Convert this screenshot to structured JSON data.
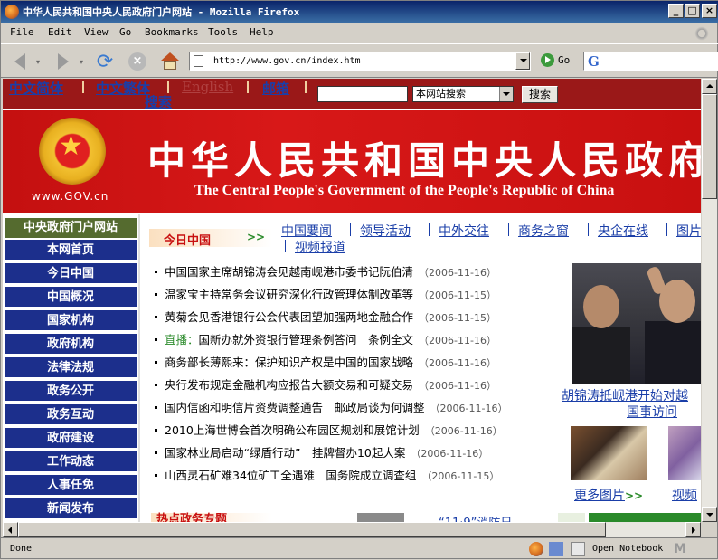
{
  "window": {
    "title": "中华人民共和国中央人民政府门户网站 - Mozilla Firefox",
    "buttons": {
      "minimize": "_",
      "maximize": "□",
      "close": "×"
    }
  },
  "menu": [
    "File",
    "Edit",
    "View",
    "Go",
    "Bookmarks",
    "Tools",
    "Help"
  ],
  "toolbar": {
    "url": "http://www.gov.cn/index.htm",
    "go_label": "Go",
    "search_engine_glyph": "G"
  },
  "status": {
    "text": "Done",
    "notebook_label": "Open Notebook"
  },
  "page": {
    "lang_links": [
      "中文简体",
      "中文繁体",
      "English",
      "邮箱"
    ],
    "search_label": "搜索",
    "search_scope": "本网站搜索",
    "search_button": "搜索",
    "site_url": "www.GOV.cn",
    "banner_cn": "中华人民共和国中央人民政府",
    "banner_en": "The Central People's Government of the People's Republic of China",
    "sidebar_title": "中央政府门户网站",
    "sidebar_items": [
      "本网首页",
      "今日中国",
      "中国概况",
      "国家机构",
      "政府机构",
      "法律法规",
      "政务公开",
      "政务互动",
      "政府建设",
      "工作动态",
      "人事任免",
      "新闻发布"
    ],
    "today_label": "今日中国",
    "today_arrow": ">>",
    "tabs": [
      "中国要闻",
      "领导活动",
      "中外交往",
      "商务之窗",
      "央企在线",
      "图片"
    ],
    "tabs_row2": "视频报道",
    "news": [
      {
        "title": "中国国家主席胡锦涛会见越南岘港市委书记阮伯清",
        "date": "（2006-11-16）"
      },
      {
        "title": "温家宝主持常务会议研究深化行政管理体制改革等",
        "date": "（2006-11-15）"
      },
      {
        "title": "黄菊会见香港银行公会代表团望加强两地金融合作",
        "date": "（2006-11-15）"
      },
      {
        "prefix": "直播：",
        "title": "国新办就外资银行管理条例答问　条例全文",
        "date": "（2006-11-16）"
      },
      {
        "title": "商务部长薄熙来：保护知识产权是中国的国家战略",
        "date": "（2006-11-16）"
      },
      {
        "title": "央行发布规定金融机构应报告大额交易和可疑交易",
        "date": "（2006-11-16）"
      },
      {
        "title": "国内信函和明信片资费调整通告　邮政局谈为何调整",
        "date": "（2006-11-16）"
      },
      {
        "title": "2010上海世博会首次明确公布园区规划和展馆计划",
        "date": "（2006-11-16）"
      },
      {
        "title": "国家林业局启动“绿盾行动”　挂牌督办10起大案",
        "date": "（2006-11-16）"
      },
      {
        "title": "山西灵石矿难34位矿工全遇难　国务院成立调查组",
        "date": "（2006-11-15）"
      }
    ],
    "photo_caption_1": "胡锦涛抵岘港开始对越",
    "photo_caption_2": "国事访问",
    "more_pics": "更多图片",
    "more_arrow": ">>",
    "video_label": "视频",
    "hot_label": "热点政务专题",
    "bottom_link": "“11·9”消防日"
  }
}
